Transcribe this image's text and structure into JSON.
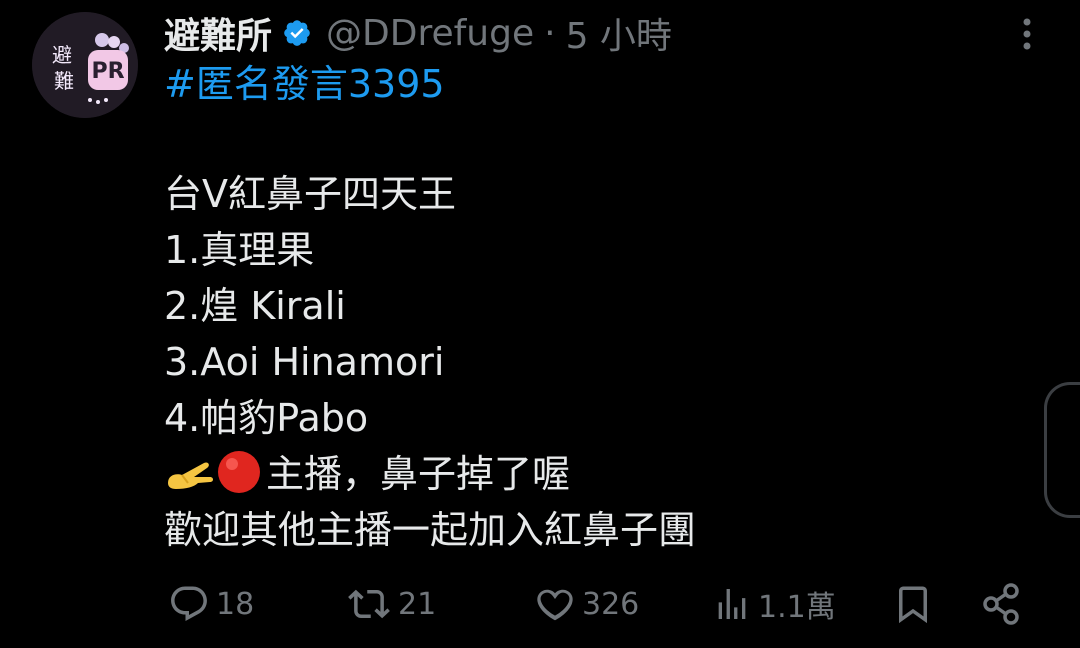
{
  "tweet": {
    "display_name": "避難所",
    "handle": "@DDrefuge",
    "separator": "·",
    "time": "5 小時",
    "hashtag": "#匿名發言3395",
    "lines": [
      "台V紅鼻子四天王",
      "1.真理果",
      "2.煌 Kirali",
      "3.Aoi Hinamori",
      "4.帕豹Pabo",
      "主播，鼻子掉了喔",
      "歡迎其他主播一起加入紅鼻子團"
    ],
    "avatar_text": "避難PR"
  },
  "actions": {
    "reply_count": "18",
    "retweet_count": "21",
    "like_count": "326",
    "views_count": "1.1萬"
  },
  "icons": {
    "verified": "verified-badge-icon",
    "more": "more-vertical-icon",
    "reply": "reply-icon",
    "retweet": "retweet-icon",
    "like": "heart-icon",
    "views": "views-chart-icon",
    "bookmark": "bookmark-icon",
    "share": "share-icon"
  },
  "colors": {
    "background": "#000000",
    "text": "#e7e9ea",
    "muted": "#71767b",
    "link": "#1d9bf0"
  }
}
